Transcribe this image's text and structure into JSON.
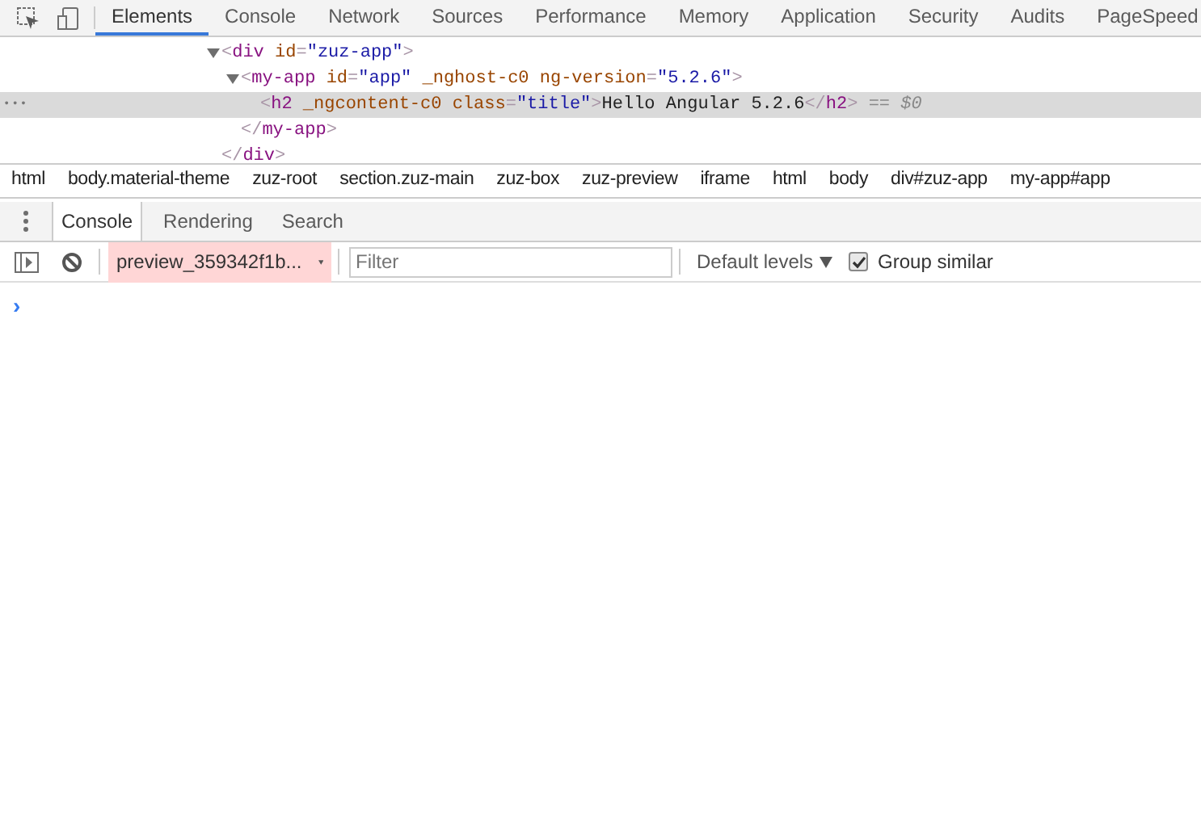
{
  "tabs": [
    {
      "label": "Elements",
      "selected": true
    },
    {
      "label": "Console",
      "selected": false
    },
    {
      "label": "Network",
      "selected": false
    },
    {
      "label": "Sources",
      "selected": false
    },
    {
      "label": "Performance",
      "selected": false
    },
    {
      "label": "Memory",
      "selected": false
    },
    {
      "label": "Application",
      "selected": false
    },
    {
      "label": "Security",
      "selected": false
    },
    {
      "label": "Audits",
      "selected": false
    },
    {
      "label": "PageSpeed",
      "selected": false
    }
  ],
  "dom_tree": [
    {
      "expanded": true,
      "selected": false,
      "tokens": [
        {
          "kind": "punct",
          "text": "<"
        },
        {
          "kind": "tag",
          "text": "div"
        },
        {
          "kind": "attr",
          "text": " id"
        },
        {
          "kind": "punct",
          "text": "="
        },
        {
          "kind": "value",
          "text": "\"zuz-app\""
        },
        {
          "kind": "punct",
          "text": ">"
        }
      ],
      "children": [
        {
          "expanded": true,
          "selected": false,
          "tokens": [
            {
              "kind": "punct",
              "text": "<"
            },
            {
              "kind": "tag",
              "text": "my-app"
            },
            {
              "kind": "attr",
              "text": " id"
            },
            {
              "kind": "punct",
              "text": "="
            },
            {
              "kind": "value",
              "text": "\"app\""
            },
            {
              "kind": "attr",
              "text": " _nghost-c0 ng-version"
            },
            {
              "kind": "punct",
              "text": "="
            },
            {
              "kind": "value",
              "text": "\"5.2.6\""
            },
            {
              "kind": "punct",
              "text": ">"
            }
          ],
          "children": [
            {
              "selected": true,
              "gutter": "•••",
              "tokens": [
                {
                  "kind": "punct",
                  "text": "<"
                },
                {
                  "kind": "tag",
                  "text": "h2"
                },
                {
                  "kind": "attr",
                  "text": " _ngcontent-c0 class"
                },
                {
                  "kind": "punct",
                  "text": "="
                },
                {
                  "kind": "value",
                  "text": "\"title\""
                },
                {
                  "kind": "punct",
                  "text": ">"
                },
                {
                  "kind": "text",
                  "text": "Hello Angular 5.2.6"
                },
                {
                  "kind": "punct",
                  "text": "</"
                },
                {
                  "kind": "tag",
                  "text": "h2"
                },
                {
                  "kind": "punct",
                  "text": ">"
                },
                {
                  "kind": "marker",
                  "text": " == $0"
                }
              ]
            }
          ],
          "closing": [
            {
              "kind": "punct",
              "text": "</"
            },
            {
              "kind": "tag",
              "text": "my-app"
            },
            {
              "kind": "punct",
              "text": ">"
            }
          ]
        }
      ],
      "closing": [
        {
          "kind": "punct",
          "text": "</"
        },
        {
          "kind": "tag",
          "text": "div"
        },
        {
          "kind": "punct",
          "text": ">"
        }
      ]
    }
  ],
  "breadcrumbs": [
    "html",
    "body.material-theme",
    "zuz-root",
    "section.zuz-main",
    "zuz-box",
    "zuz-preview",
    "iframe",
    "html",
    "body",
    "div#zuz-app",
    "my-app#app"
  ],
  "drawer_tabs": [
    {
      "label": "Console",
      "selected": true
    },
    {
      "label": "Rendering",
      "selected": false
    },
    {
      "label": "Search",
      "selected": false
    }
  ],
  "console_toolbar": {
    "context": "preview_359342f1b...",
    "filter": {
      "placeholder": "Filter"
    },
    "levels": "Default levels",
    "group_similar": {
      "label": "Group similar",
      "checked": true
    }
  },
  "prompt": "›"
}
